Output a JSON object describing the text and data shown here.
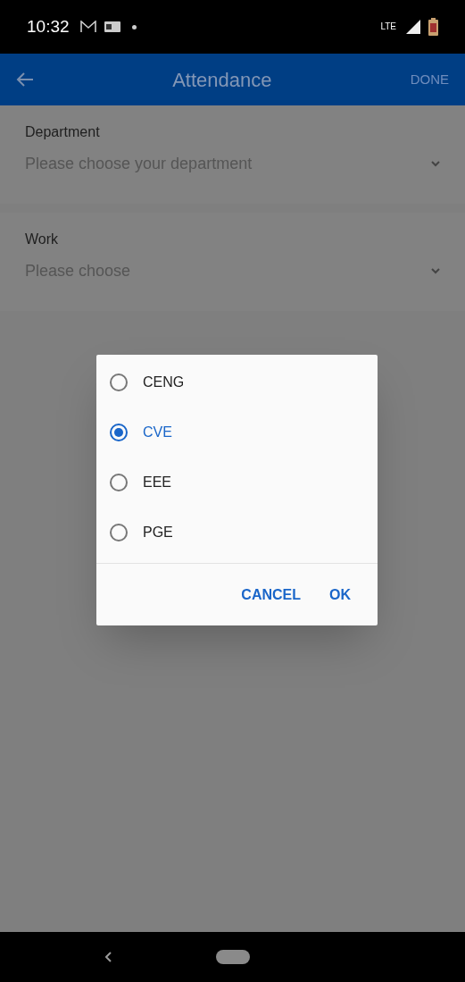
{
  "status_bar": {
    "time": "10:32",
    "network": "LTE"
  },
  "app_bar": {
    "title": "Attendance",
    "action": "DONE"
  },
  "fields": [
    {
      "label": "Department",
      "placeholder": "Please choose your department"
    },
    {
      "label": "Work",
      "placeholder": "Please choose"
    }
  ],
  "dialog": {
    "options": [
      {
        "label": "CENG",
        "selected": false
      },
      {
        "label": "CVE",
        "selected": true
      },
      {
        "label": "EEE",
        "selected": false
      },
      {
        "label": "PGE",
        "selected": false
      }
    ],
    "buttons": [
      "CANCEL",
      "OK"
    ]
  }
}
